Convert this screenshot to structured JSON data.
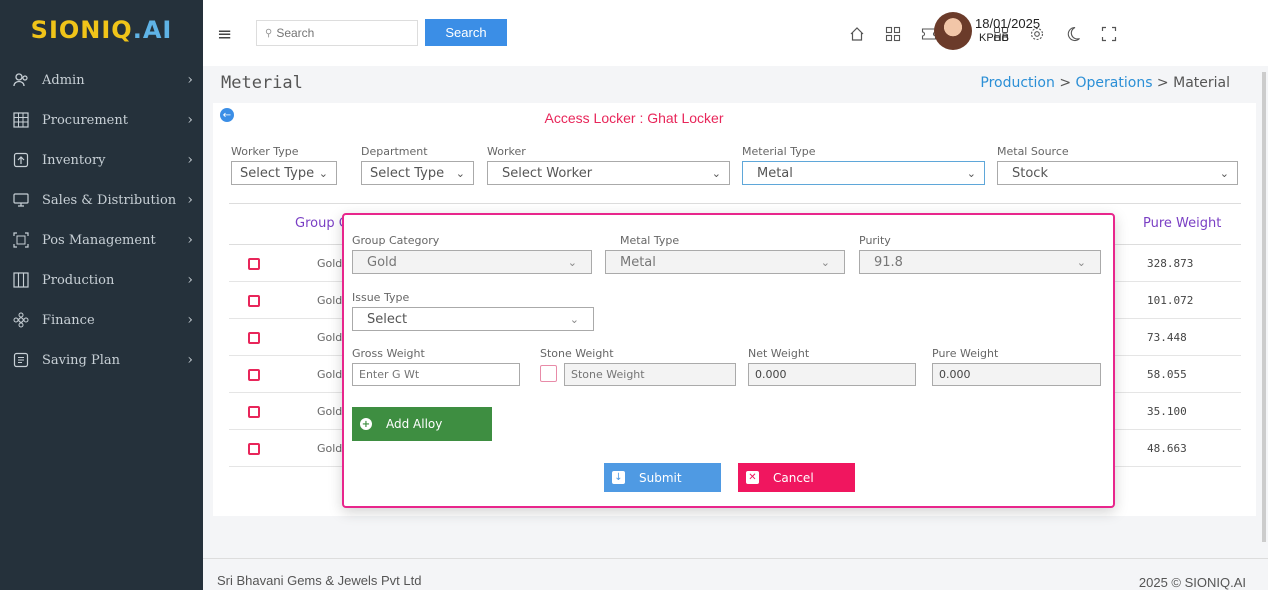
{
  "brand": {
    "logo": "SIONIQ.AI",
    "logo_left": "SIONIQ",
    "logo_right": ".AI"
  },
  "sidebar": {
    "items": [
      {
        "label": "Admin",
        "icon": "users-icon"
      },
      {
        "label": "Procurement",
        "icon": "grid-icon"
      },
      {
        "label": "Inventory",
        "icon": "upload-box-icon"
      },
      {
        "label": "Sales & Distribution",
        "icon": "monitor-icon"
      },
      {
        "label": "Pos Management",
        "icon": "frame-icon"
      },
      {
        "label": "Production",
        "icon": "columns-icon"
      },
      {
        "label": "Finance",
        "icon": "gear-flower-icon"
      },
      {
        "label": "Saving Plan",
        "icon": "list-box-icon"
      }
    ]
  },
  "topbar": {
    "search_placeholder": "Search",
    "search_button": "Search",
    "user_date": "18/01/2025",
    "user_branch": "KPHB"
  },
  "page": {
    "title": "Meterial",
    "breadcrumb": {
      "level1": "Production",
      "sep": " > ",
      "level2": "Operations",
      "current": "Material"
    },
    "access_locker_label": "Access Locker : ",
    "access_locker_value": "Ghat Locker"
  },
  "filters": {
    "worker_type": {
      "label": "Worker Type",
      "value": "Select Type"
    },
    "department": {
      "label": "Department",
      "value": "Select Type"
    },
    "worker": {
      "label": "Worker",
      "value": "Select Worker"
    },
    "material_type": {
      "label": "Meterial Type",
      "value": "Metal"
    },
    "metal_source": {
      "label": "Metal Source",
      "value": "Stock"
    }
  },
  "table": {
    "header_group": "Group C",
    "header_pure": "Pure Weight",
    "rows": [
      {
        "group": "Gold",
        "pure": "328.873"
      },
      {
        "group": "Gold",
        "pure": "101.072"
      },
      {
        "group": "Gold",
        "pure": "73.448"
      },
      {
        "group": "Gold",
        "pure": "58.055"
      },
      {
        "group": "Gold",
        "pure": "35.100"
      },
      {
        "group": "Gold",
        "pure": "48.663"
      }
    ]
  },
  "modal": {
    "group_category": {
      "label": "Group Category",
      "value": "Gold"
    },
    "metal_type": {
      "label": "Metal Type",
      "value": "Metal"
    },
    "purity": {
      "label": "Purity",
      "value": "91.8"
    },
    "issue_type": {
      "label": "Issue Type",
      "value": "Select"
    },
    "gross_weight": {
      "label": "Gross Weight",
      "placeholder": "Enter G Wt"
    },
    "stone_weight": {
      "label": "Stone Weight",
      "placeholder": "Stone Weight"
    },
    "net_weight": {
      "label": "Net Weight",
      "value": "0.000"
    },
    "pure_weight": {
      "label": "Pure Weight",
      "value": "0.000"
    },
    "add_alloy": "Add Alloy",
    "submit": "Submit",
    "cancel": "Cancel"
  },
  "footer": {
    "company": "Sri Bhavani Gems & Jewels Pvt Ltd",
    "copyright": "2025 © SIONIQ.AI"
  },
  "colors": {
    "sidebar_bg": "#25313b",
    "primary": "#3b8ee6",
    "accent_pink": "#e8268c",
    "success": "#3e8e41",
    "danger": "#f0165f",
    "header_text": "#7a3fc4"
  }
}
